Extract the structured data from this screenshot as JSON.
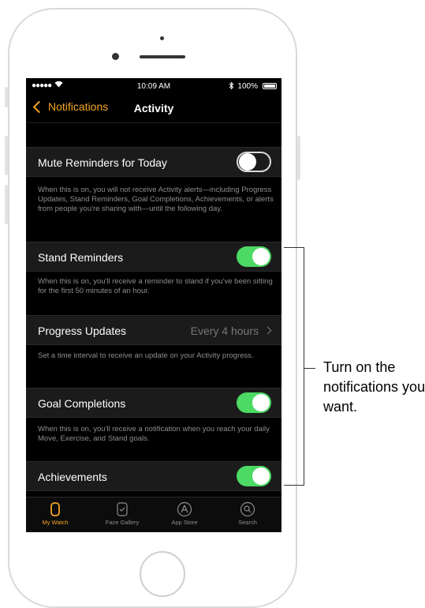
{
  "status_bar": {
    "signal": "●●●●●",
    "time": "10:09 AM",
    "battery": "100%"
  },
  "nav": {
    "back_label": "Notifications",
    "title": "Activity"
  },
  "settings": {
    "mute_reminders": {
      "label": "Mute Reminders for Today",
      "state": "off",
      "note": "When this is on, you will not receive Activity alerts—including Progress Updates, Stand Reminders, Goal Completions, Achievements, or alerts from people you're sharing with—until the following day."
    },
    "stand_reminders": {
      "label": "Stand Reminders",
      "state": "on",
      "note": "When this is on, you'll receive a reminder to stand if you've been sitting for the first 50 minutes of an hour."
    },
    "progress_updates": {
      "label": "Progress Updates",
      "value": "Every 4 hours",
      "note": "Set a time interval to receive an update on your Activity progress."
    },
    "goal_completions": {
      "label": "Goal Completions",
      "state": "on",
      "note": "When this is on, you'll receive a notification when you reach your daily Move, Exercise, and Stand goals."
    },
    "achievements": {
      "label": "Achievements",
      "state": "on"
    }
  },
  "tabs": [
    {
      "label": "My Watch",
      "icon": "watch-icon",
      "active": true
    },
    {
      "label": "Face Gallery",
      "icon": "face-gallery-icon",
      "active": false
    },
    {
      "label": "App Store",
      "icon": "app-store-icon",
      "active": false
    },
    {
      "label": "Search",
      "icon": "search-icon",
      "active": false
    }
  ],
  "callout": {
    "text": "Turn on the notifications you want."
  },
  "colors": {
    "accent": "#f5a623",
    "toggle_on": "#4cd964",
    "background": "#000000"
  }
}
